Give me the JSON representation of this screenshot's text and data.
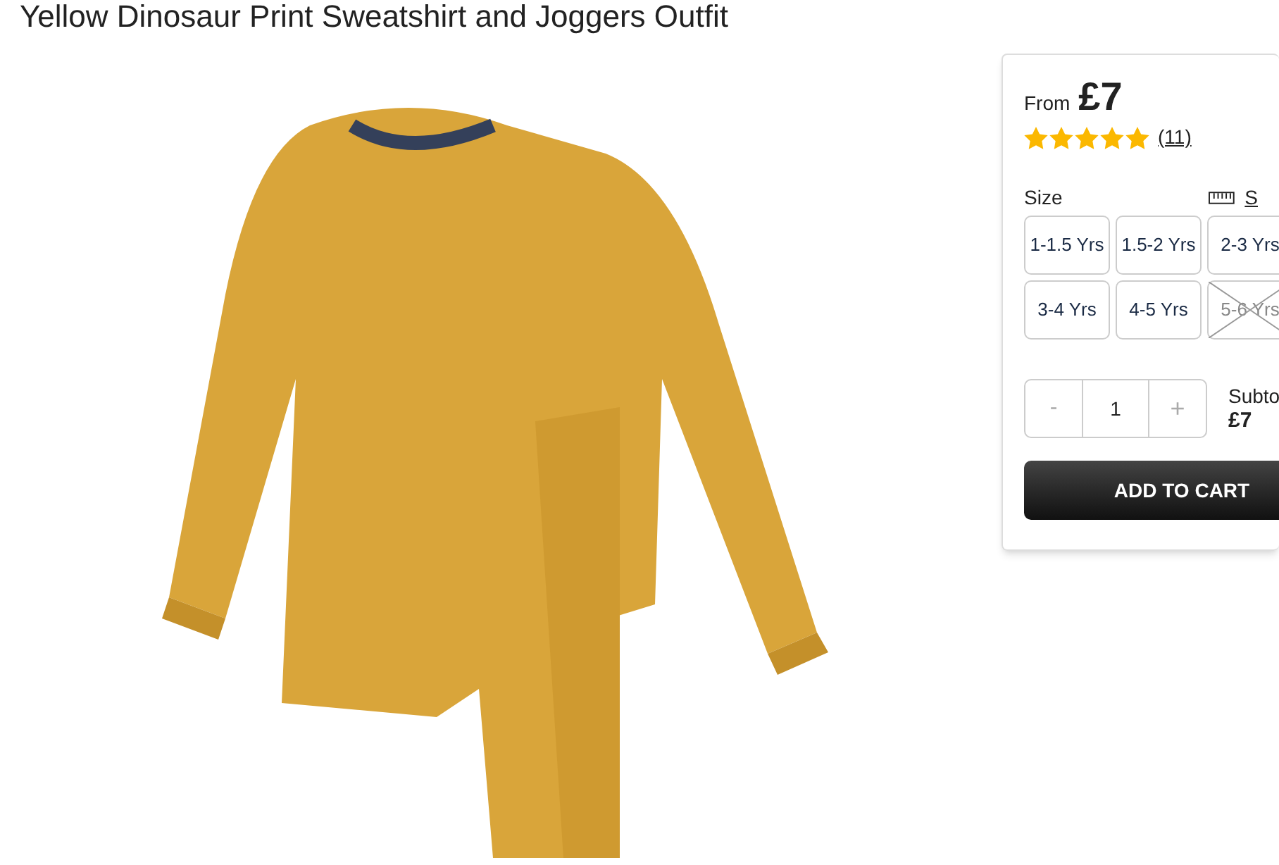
{
  "product": {
    "title": "Yellow Dinosaur Print Sweatshirt and Joggers Outfit"
  },
  "purchase_panel": {
    "price_prefix": "From",
    "price": "£7",
    "stars": 5,
    "review_count": "(11)",
    "size_label": "Size",
    "size_guide_link": "S",
    "sizes": [
      {
        "label": "1-1.5 Yrs",
        "available": true
      },
      {
        "label": "1.5-2 Yrs",
        "available": true
      },
      {
        "label": "2-3 Yrs",
        "available": true
      },
      {
        "label": "3-4 Yrs",
        "available": true
      },
      {
        "label": "4-5 Yrs",
        "available": true
      },
      {
        "label": "5-6 Yrs",
        "available": false
      }
    ],
    "quantity": {
      "decrement": "-",
      "value": "1",
      "increment": "+"
    },
    "subtotal_label": "Subto",
    "subtotal": "£7",
    "add_button": "ADD TO CART"
  }
}
